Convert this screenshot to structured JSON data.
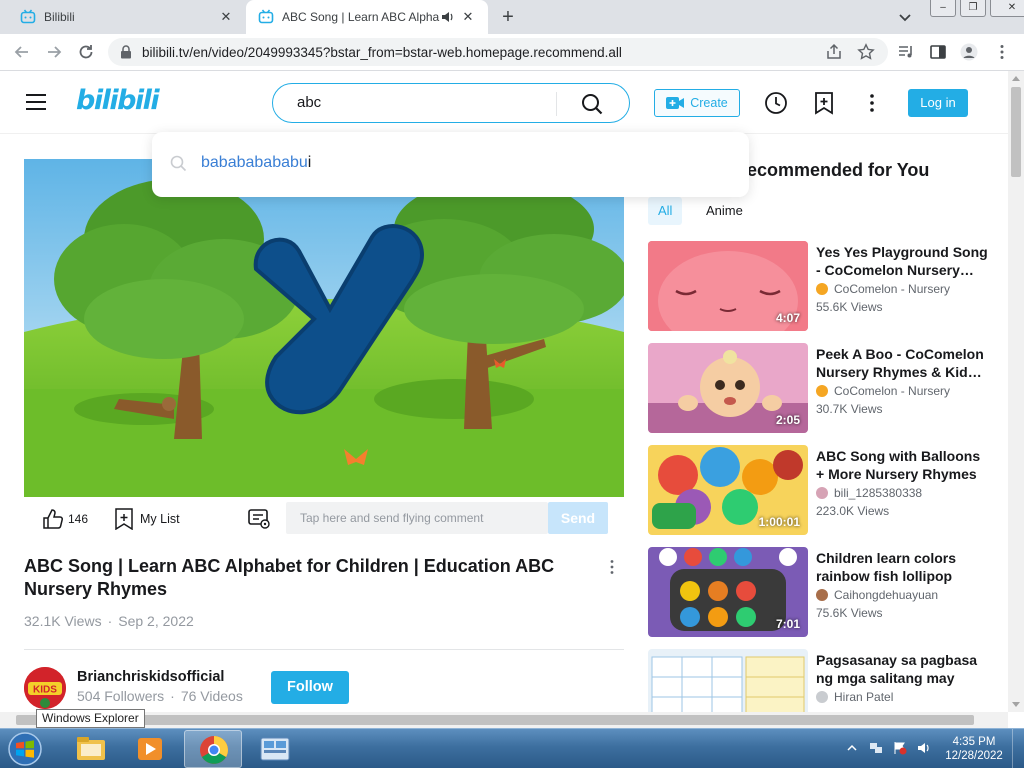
{
  "browser": {
    "tabs": [
      {
        "title": "Bilibili",
        "active": false
      },
      {
        "title": "ABC Song | Learn ABC Alphabet for Children",
        "active": true
      }
    ],
    "url": "bilibili.tv/en/video/2049993345?bstar_from=bstar-web.homepage.recommend.all"
  },
  "site": {
    "logo": "bilibili",
    "search_value": "abc",
    "create_label": "Create",
    "login_label": "Log in",
    "accent": "#23ade5"
  },
  "suggestions": [
    {
      "highlight": "babababababu",
      "rest": "i"
    }
  ],
  "player": {
    "like_count": "146",
    "mylist_label": "My List",
    "danmaku_placeholder": "Tap here and send flying comment",
    "send_label": "Send"
  },
  "video": {
    "title": "ABC Song | Learn ABC Alphabet for Children | Education ABC Nursery Rhymes",
    "views": "32.1K Views",
    "date": "Sep 2, 2022"
  },
  "uploader": {
    "name": "Brianchriskidsofficial",
    "followers": "504 Followers",
    "videos": "76 Videos",
    "follow_label": "Follow",
    "avatar_text": "KIDS"
  },
  "recommended": {
    "heading": "Recommended for You",
    "chips": [
      "All",
      "Anime"
    ],
    "items": [
      {
        "title": "Yes Yes Playground Song - CoComelon Nursery Rhymes",
        "uploader": "CoComelon - Nursery",
        "views": "55.6K Views",
        "duration": "4:07"
      },
      {
        "title": "Peek A Boo - CoComelon Nursery Rhymes & Kids Songs",
        "uploader": "CoComelon - Nursery",
        "views": "30.7K Views",
        "duration": "2:05"
      },
      {
        "title": "ABC Song with Balloons + More Nursery Rhymes",
        "uploader": "bili_1285380338",
        "views": "223.0K Views",
        "duration": "1:00:01"
      },
      {
        "title": "Children learn colors rainbow fish lollipop",
        "uploader": "Caihongdehuayuan",
        "views": "75.6K Views",
        "duration": "7:01"
      },
      {
        "title": "Pagsasanay sa pagbasa ng mga salitang may",
        "uploader": "Hiran Patel",
        "views": "",
        "duration": ""
      }
    ]
  },
  "tooltip": "Windows Explorer",
  "taskbar": {
    "time": "4:35 PM",
    "date": "12/28/2022"
  }
}
